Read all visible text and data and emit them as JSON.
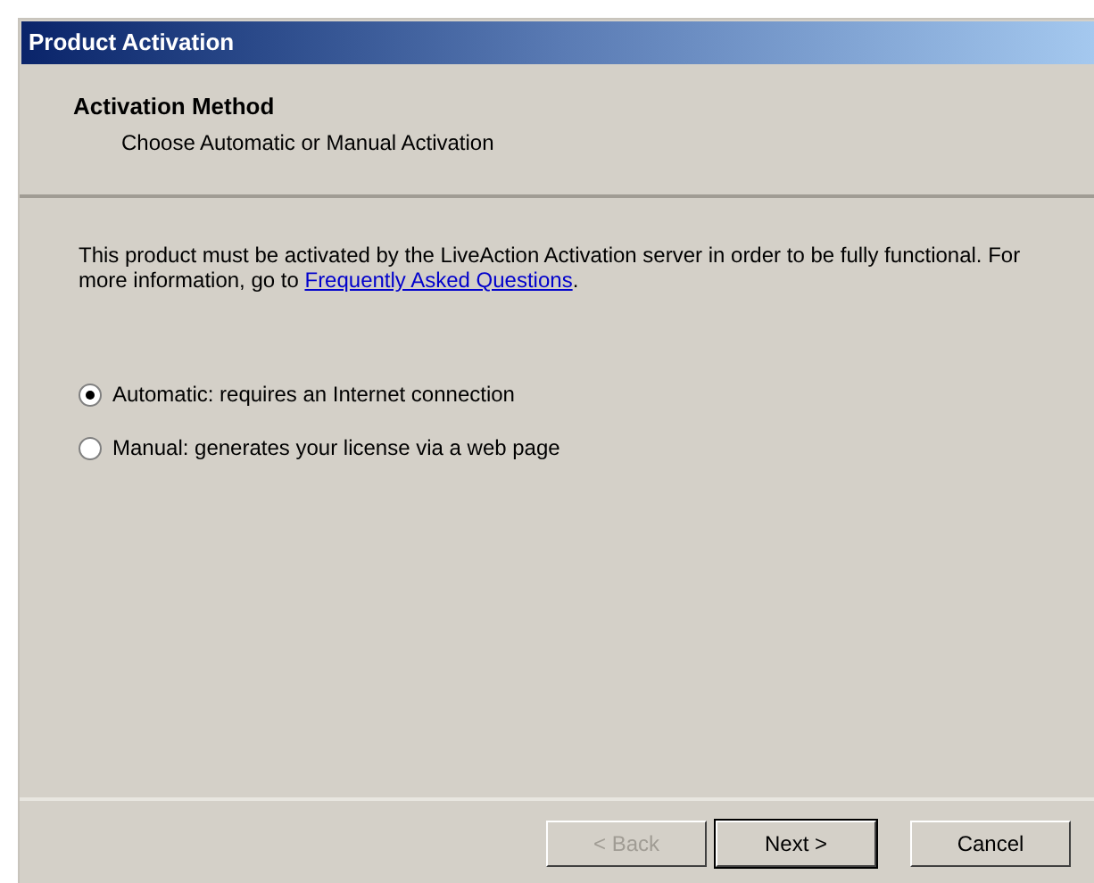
{
  "window": {
    "title": "Product Activation"
  },
  "header": {
    "title": "Activation Method",
    "subtitle": "Choose Automatic or Manual Activation"
  },
  "intro": {
    "text_before": "This product must be activated by the LiveAction Activation server in order to be fully functional. For more information, go to ",
    "link": "Frequently Asked Questions",
    "text_after": "."
  },
  "options": [
    {
      "label": "Automatic: requires an Internet connection",
      "selected": true
    },
    {
      "label": "Manual: generates your license via a web page",
      "selected": false
    }
  ],
  "buttons": [
    {
      "label": "< Back",
      "disabled": true,
      "default": false
    },
    {
      "label": "Next >",
      "disabled": false,
      "default": true
    },
    {
      "label": "Cancel",
      "disabled": false,
      "default": false
    }
  ]
}
